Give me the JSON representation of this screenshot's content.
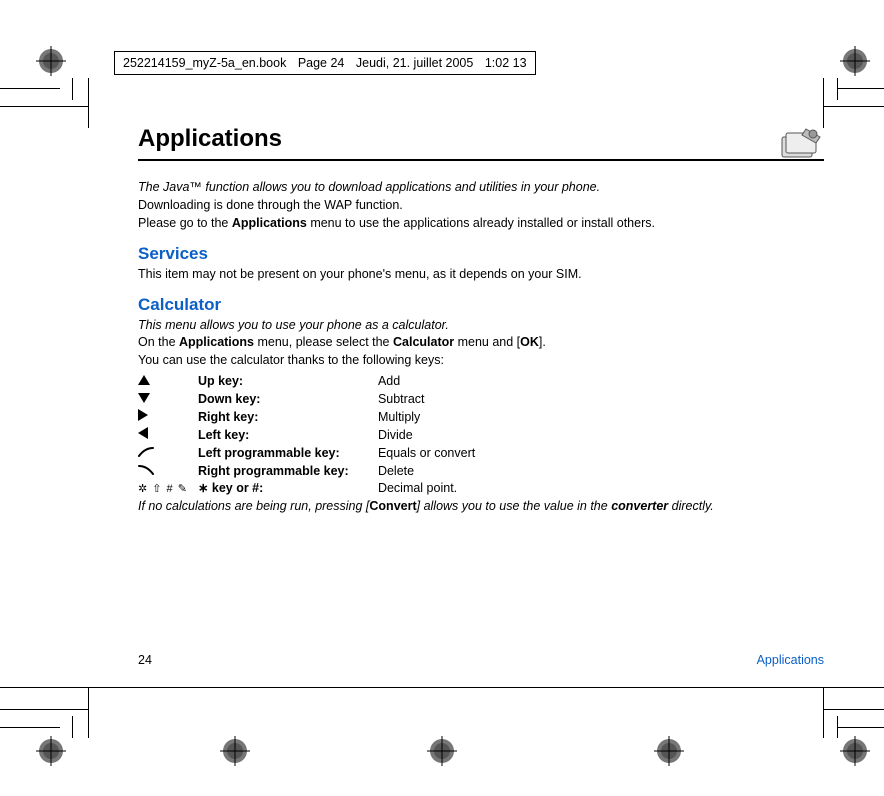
{
  "header": {
    "filename": "252214159_myZ-5a_en.book",
    "page_part": "Page 24",
    "date_part": "Jeudi, 21. juillet 2005",
    "time_part": "1:02 13"
  },
  "title": "Applications",
  "intro": {
    "line1": "The Java™ function allows you to download applications and utilities in your phone.",
    "line2_pre": "Downloading is done through the WAP function.",
    "line3_pre": "Please go to the ",
    "line3_bold": "Applications",
    "line3_post": " menu to use the applications already installed or install others."
  },
  "services": {
    "heading": "Services",
    "body": "This item may not be present on your phone's menu, as it depends on your SIM."
  },
  "calculator": {
    "heading": "Calculator",
    "intro_italic": "This menu allows you to use your phone as a calculator.",
    "line2_pre": "On the ",
    "line2_b1": "Applications",
    "line2_mid": " menu, please select the ",
    "line2_b2": "Calculator",
    "line2_mid2": " menu and [",
    "line2_b3": "OK",
    "line2_post": "].",
    "line3": "You can use the calculator thanks to the following keys:",
    "keys": [
      {
        "icon": "up",
        "label": "Up key:",
        "desc": "Add"
      },
      {
        "icon": "down",
        "label": "Down key:",
        "desc": "Subtract"
      },
      {
        "icon": "right",
        "label": "Right key:",
        "desc": "Multiply"
      },
      {
        "icon": "left",
        "label": "Left key:",
        "desc": "Divide"
      },
      {
        "icon": "softleft",
        "label": "Left programmable key:",
        "desc": "Equals or convert"
      },
      {
        "icon": "softright",
        "label": "Right programmable key:",
        "desc": "Delete"
      },
      {
        "icon": "starhash",
        "label": "∗ key or #:",
        "label_glyphs": "✲ ⇧ # ✎",
        "desc": "Decimal point."
      }
    ],
    "footnote_pre": "If no calculations are being run, pressing [",
    "footnote_b1": "Convert",
    "footnote_mid": "] allows you to use the value in the ",
    "footnote_b2": "converter",
    "footnote_post": " directly."
  },
  "footer": {
    "page": "24",
    "section": "Applications"
  }
}
